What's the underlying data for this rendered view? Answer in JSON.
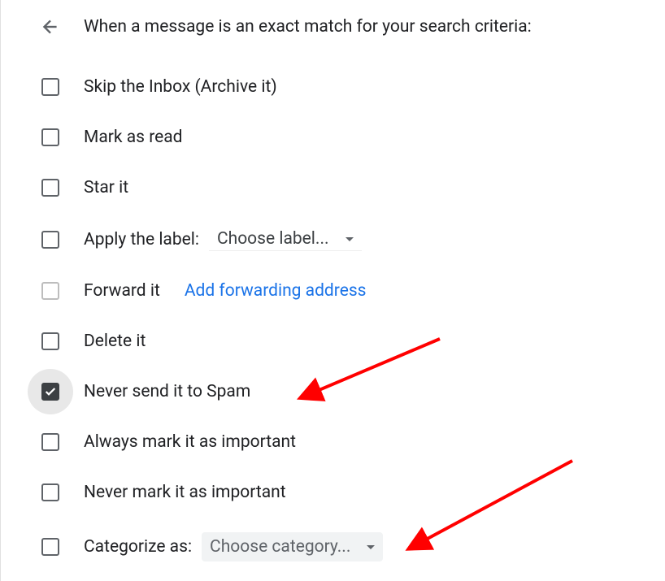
{
  "header": {
    "title": "When a message is an exact match for your search criteria:"
  },
  "options": {
    "skip_inbox": "Skip the Inbox (Archive it)",
    "mark_read": "Mark as read",
    "star_it": "Star it",
    "apply_label": "Apply the label:",
    "label_dropdown": "Choose label...",
    "forward_it": "Forward it",
    "forward_link": "Add forwarding address",
    "delete_it": "Delete it",
    "never_spam": "Never send it to Spam",
    "always_important": "Always mark it as important",
    "never_important": "Never mark it as important",
    "categorize": "Categorize as:",
    "category_dropdown": "Choose category..."
  },
  "state": {
    "never_spam_checked": true,
    "forward_disabled": true
  }
}
